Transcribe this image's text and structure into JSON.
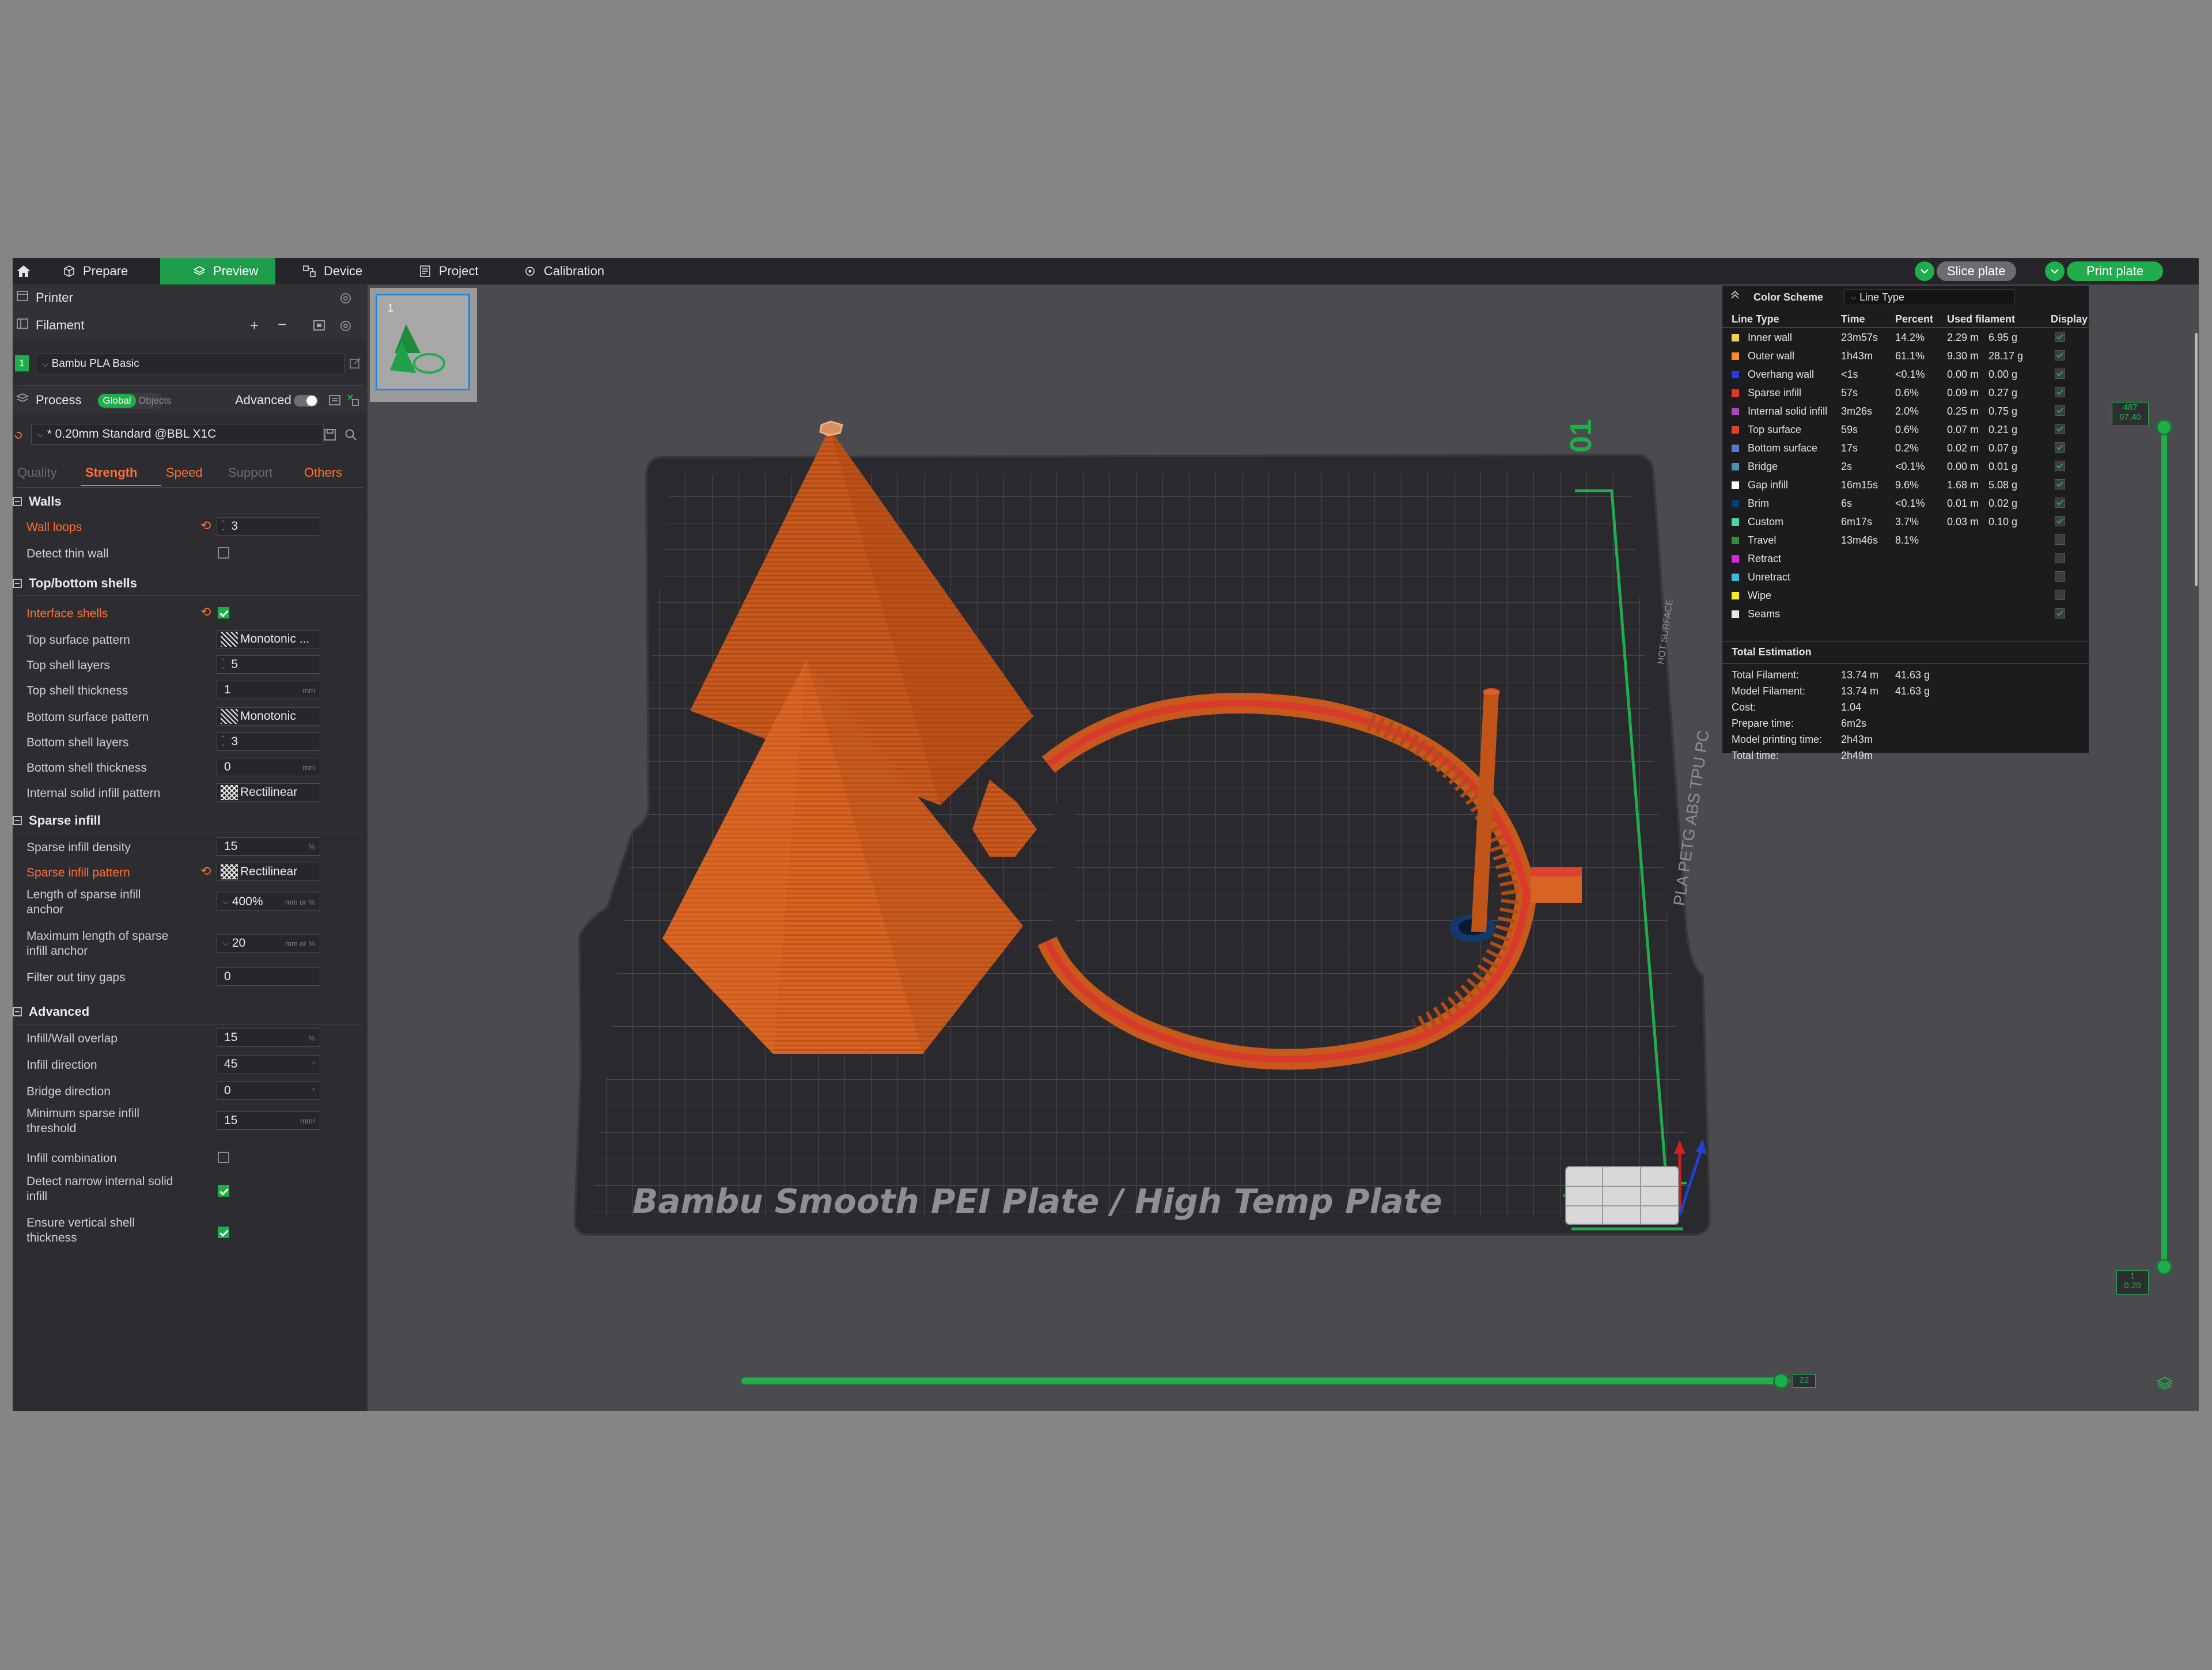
{
  "topbar": {
    "tabs": [
      {
        "label": "Prepare"
      },
      {
        "label": "Preview"
      },
      {
        "label": "Device"
      },
      {
        "label": "Project"
      },
      {
        "label": "Calibration"
      }
    ],
    "slice_label": "Slice plate",
    "print_label": "Print plate"
  },
  "left": {
    "printer_label": "Printer",
    "filament_label": "Filament",
    "filament_index": "1",
    "filament_name": "Bambu PLA Basic",
    "process_label": "Process",
    "global_label": "Global",
    "objects_label": "Objects",
    "advanced_label": "Advanced",
    "process_preset": "* 0.20mm Standard @BBL X1C",
    "tabs": [
      "Quality",
      "Strength",
      "Speed",
      "Support",
      "Others"
    ],
    "groups": {
      "walls": "Walls",
      "topbottom": "Top/bottom shells",
      "sparse": "Sparse infill",
      "advanced": "Advanced"
    },
    "params": {
      "wall_loops": {
        "label": "Wall loops",
        "value": "3"
      },
      "detect_thin_wall": {
        "label": "Detect thin wall"
      },
      "interface_shells": {
        "label": "Interface shells"
      },
      "top_surface_pattern": {
        "label": "Top surface pattern",
        "value": "Monotonic ..."
      },
      "top_shell_layers": {
        "label": "Top shell layers",
        "value": "5"
      },
      "top_shell_thickness": {
        "label": "Top shell thickness",
        "value": "1",
        "unit": "mm"
      },
      "bottom_surface_pattern": {
        "label": "Bottom surface pattern",
        "value": "Monotonic"
      },
      "bottom_shell_layers": {
        "label": "Bottom shell layers",
        "value": "3"
      },
      "bottom_shell_thickness": {
        "label": "Bottom shell thickness",
        "value": "0",
        "unit": "mm"
      },
      "internal_solid_infill_pattern": {
        "label": "Internal solid infill pattern",
        "value": "Rectilinear"
      },
      "sparse_infill_density": {
        "label": "Sparse infill density",
        "value": "15",
        "unit": "%"
      },
      "sparse_infill_pattern": {
        "label": "Sparse infill pattern",
        "value": "Rectilinear"
      },
      "sparse_infill_anchor": {
        "label1": "Length of sparse infill",
        "label2": "anchor",
        "value": "400%",
        "unit": "mm or %"
      },
      "sparse_infill_anchor_max": {
        "label1": "Maximum length of sparse",
        "label2": "infill anchor",
        "value": "20",
        "unit": "mm or %"
      },
      "filter_tiny_gaps": {
        "label": "Filter out tiny gaps",
        "value": "0"
      },
      "infill_wall_overlap": {
        "label": "Infill/Wall overlap",
        "value": "15",
        "unit": "%"
      },
      "infill_direction": {
        "label": "Infill direction",
        "value": "45",
        "unit": "°"
      },
      "bridge_direction": {
        "label": "Bridge direction",
        "value": "0",
        "unit": "°"
      },
      "min_sparse_infill_threshold": {
        "label1": "Minimum sparse infill",
        "label2": "threshold",
        "value": "15",
        "unit": "mm²"
      },
      "infill_combination": {
        "label": "Infill combination"
      },
      "detect_narrow_internal_solid_infill": {
        "label1": "Detect narrow internal solid",
        "label2": "infill"
      },
      "ensure_vertical_shell_thickness": {
        "label1": "Ensure vertical shell",
        "label2": "thickness"
      }
    }
  },
  "plate": {
    "thumb_number": "1",
    "plate_number": "01",
    "plate_name": "Bambu Smooth PEI Plate / High Temp Plate",
    "plate_side_text": "PLA PETG ABS TPU PC",
    "plate_side_text2": "HOT SURFACE"
  },
  "legend": {
    "title": "Color Scheme",
    "scheme": "Line Type",
    "headers": [
      "Line Type",
      "Time",
      "Percent",
      "Used filament",
      "Display"
    ],
    "rows": [
      {
        "name": "Inner wall",
        "color": "#f2d24a",
        "time": "23m57s",
        "percent": "14.2%",
        "length": "2.29 m",
        "weight": "6.95 g",
        "display": true
      },
      {
        "name": "Outer wall",
        "color": "#ff8a2a",
        "time": "1h43m",
        "percent": "61.1%",
        "length": "9.30 m",
        "weight": "28.17 g",
        "display": true
      },
      {
        "name": "Overhang wall",
        "color": "#2a3adf",
        "time": "<1s",
        "percent": "<0.1%",
        "length": "0.00 m",
        "weight": "0.00 g",
        "display": true
      },
      {
        "name": "Sparse infill",
        "color": "#d83a2c",
        "time": "57s",
        "percent": "0.6%",
        "length": "0.09 m",
        "weight": "0.27 g",
        "display": true
      },
      {
        "name": "Internal solid infill",
        "color": "#a548b8",
        "time": "3m26s",
        "percent": "2.0%",
        "length": "0.25 m",
        "weight": "0.75 g",
        "display": true
      },
      {
        "name": "Top surface",
        "color": "#e0402f",
        "time": "59s",
        "percent": "0.6%",
        "length": "0.07 m",
        "weight": "0.21 g",
        "display": true
      },
      {
        "name": "Bottom surface",
        "color": "#5a78c8",
        "time": "17s",
        "percent": "0.2%",
        "length": "0.02 m",
        "weight": "0.07 g",
        "display": true
      },
      {
        "name": "Bridge",
        "color": "#4c8fb0",
        "time": "2s",
        "percent": "<0.1%",
        "length": "0.00 m",
        "weight": "0.01 g",
        "display": true
      },
      {
        "name": "Gap infill",
        "color": "#ffffff",
        "time": "16m15s",
        "percent": "9.6%",
        "length": "1.68 m",
        "weight": "5.08 g",
        "display": true
      },
      {
        "name": "Brim",
        "color": "#0c3c6a",
        "time": "6s",
        "percent": "<0.1%",
        "length": "0.01 m",
        "weight": "0.02 g",
        "display": true
      },
      {
        "name": "Custom",
        "color": "#4ed6a0",
        "time": "6m17s",
        "percent": "3.7%",
        "length": "0.03 m",
        "weight": "0.10 g",
        "display": true
      },
      {
        "name": "Travel",
        "color": "#2f8f3a",
        "time": "13m46s",
        "percent": "8.1%",
        "length": "",
        "weight": "",
        "display": false
      },
      {
        "name": "Retract",
        "color": "#d02ad0",
        "time": "",
        "percent": "",
        "length": "",
        "weight": "",
        "display": false
      },
      {
        "name": "Unretract",
        "color": "#3fb8d8",
        "time": "",
        "percent": "",
        "length": "",
        "weight": "",
        "display": false
      },
      {
        "name": "Wipe",
        "color": "#f2e82c",
        "time": "",
        "percent": "",
        "length": "",
        "weight": "",
        "display": false
      },
      {
        "name": "Seams",
        "color": "#e8e8e8",
        "time": "",
        "percent": "",
        "length": "",
        "weight": "",
        "display": true
      }
    ],
    "total_title": "Total Estimation",
    "totals": [
      {
        "label": "Total Filament:",
        "v1": "13.74 m",
        "v2": "41.63 g"
      },
      {
        "label": "Model Filament:",
        "v1": "13.74 m",
        "v2": "41.63 g"
      },
      {
        "label": "Cost:",
        "v1": "1.04",
        "v2": ""
      },
      {
        "label": "Prepare time:",
        "v1": "6m2s",
        "v2": ""
      },
      {
        "label": "Model printing time:",
        "v1": "2h43m",
        "v2": ""
      },
      {
        "label": "Total time:",
        "v1": "2h49m",
        "v2": ""
      }
    ]
  },
  "sliders": {
    "layer_top": "487",
    "height_top": "97.40",
    "layer_bottom": "1",
    "height_bottom": "0.20",
    "move_value": "22"
  }
}
